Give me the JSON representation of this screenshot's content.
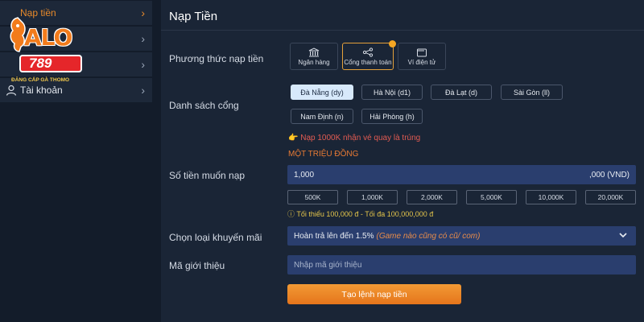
{
  "sidebar": {
    "items": [
      {
        "label": "Nạp tiền",
        "icon": "wallet-icon",
        "active": true
      },
      {
        "label": "",
        "icon": "document-icon",
        "active": false
      },
      {
        "label": "",
        "icon": "gift-icon",
        "active": false
      },
      {
        "label": "Tài khoản",
        "icon": "user-icon",
        "active": false
      }
    ],
    "logo": {
      "brand": "ALO",
      "number": "789",
      "tagline": "ĐĂNG CẤP GÀ THOMO"
    }
  },
  "main": {
    "title": "Nạp Tiền",
    "method_label": "Phương thức nạp tiền",
    "methods": [
      {
        "label": "Ngân hàng",
        "icon": "bank-icon",
        "selected": false
      },
      {
        "label": "Cổng thanh toán",
        "icon": "share-nodes-icon",
        "selected": true
      },
      {
        "label": "Ví điện tử",
        "icon": "wallet-icon",
        "selected": false
      }
    ],
    "gateway_label": "Danh sách cổng",
    "gateways": [
      {
        "label": "Đà Nẵng (dy)",
        "active": true
      },
      {
        "label": "Hà Nội (d1)",
        "active": false
      },
      {
        "label": "Đà Lạt (d)",
        "active": false
      },
      {
        "label": "Sài Gòn (ll)",
        "active": false
      },
      {
        "label": "Nam Định (n)",
        "active": false
      },
      {
        "label": "Hải Phòng (h)",
        "active": false
      }
    ],
    "promo_note": "👉 Nạp 1000K nhận vé quay là trúng",
    "amount_in_words": "MỘT TRIỆU ĐỒNG",
    "amount_label": "Số tiền muốn nạp",
    "amount_value": "1,000",
    "amount_suffix": ",000 (VND)",
    "quick_amounts": [
      "500K",
      "1,000K",
      "2,000K",
      "5,000K",
      "10,000K",
      "20,000K"
    ],
    "limit_note": "ⓘ Tối thiểu 100,000 đ - Tối đa 100,000,000 đ",
    "promo_type_label": "Chọn loại khuyến mãi",
    "promo_type_value": "Hoàn trả lên đến 1.5%",
    "promo_type_note": "(Game nào cũng có cũ/ com)",
    "referral_label": "Mã giới thiệu",
    "referral_placeholder": "Nhập mã giới thiệu",
    "submit_label": "Tạo lệnh nạp tiền"
  },
  "colors": {
    "accent": "#e88a2a",
    "input_bg": "#2a3e6e",
    "panel_bg": "#1a2536",
    "warning": "#e25b52",
    "limit": "#e3c44a"
  }
}
